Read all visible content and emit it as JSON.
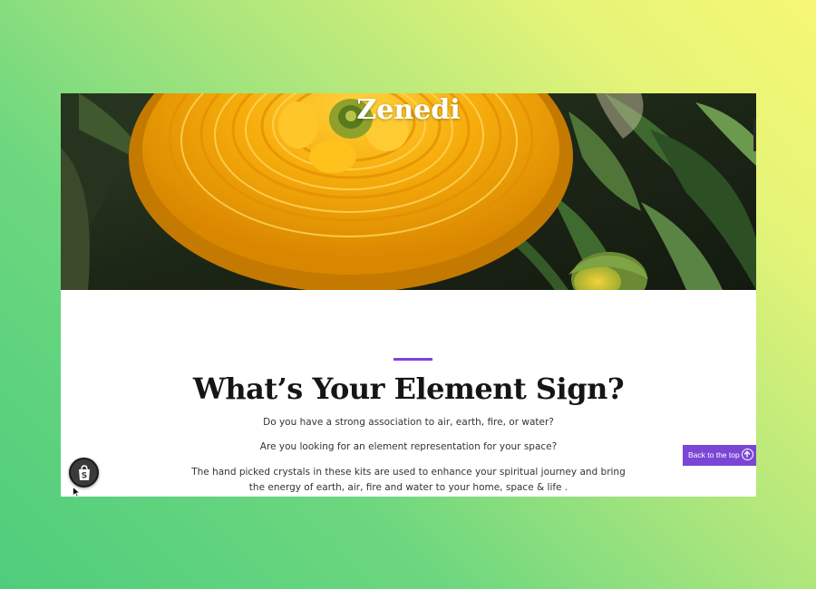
{
  "site": {
    "brand_name": "Zenedi"
  },
  "hero": {
    "image_subject": "yellow-ranunculus-flower",
    "colors": {
      "petal": "#f2a100",
      "petal_light": "#ffc21a",
      "leaves": "#3b5a2a",
      "background": "#1d2a16"
    }
  },
  "section": {
    "accent_color": "#7b46d6",
    "heading": "What’s Your Element Sign?",
    "paragraphs": [
      "Do you have a strong association to air, earth, fire, or water?",
      "Are you looking for an element representation for your space?",
      "The hand picked crystals in these kits are used to enhance your spiritual journey and bring the energy of earth, air, fire and water to your home, space & life ."
    ]
  },
  "back_to_top": {
    "label": "Back to the top",
    "icon": "arrow-up-circle-icon",
    "color": "#7b46d6"
  },
  "shopify_button": {
    "icon": "shopify-bag-icon"
  }
}
